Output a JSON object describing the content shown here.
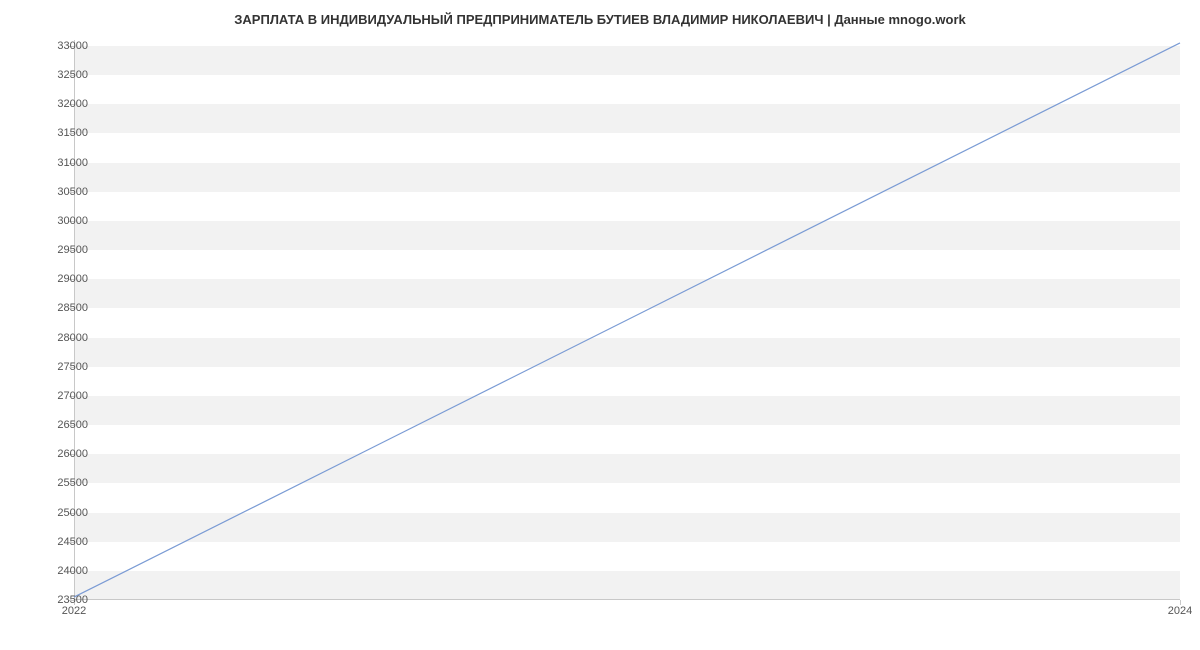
{
  "chart_data": {
    "type": "line",
    "title": "ЗАРПЛАТА В ИНДИВИДУАЛЬНЫЙ ПРЕДПРИНИМАТЕЛЬ БУТИЕВ ВЛАДИМИР НИКОЛАЕВИЧ | Данные mnogo.work",
    "xlabel": "",
    "ylabel": "",
    "x": [
      2022,
      2024
    ],
    "values": [
      23550,
      33050
    ],
    "x_ticks": [
      2022,
      2024
    ],
    "y_ticks": [
      23500,
      24000,
      24500,
      25000,
      25500,
      26000,
      26500,
      27000,
      27500,
      28000,
      28500,
      29000,
      29500,
      30000,
      30500,
      31000,
      31500,
      32000,
      32500,
      33000
    ],
    "xlim": [
      2022,
      2024
    ],
    "ylim": [
      23500,
      33100
    ],
    "grid": "banded",
    "line_color": "#7a9bd4"
  }
}
